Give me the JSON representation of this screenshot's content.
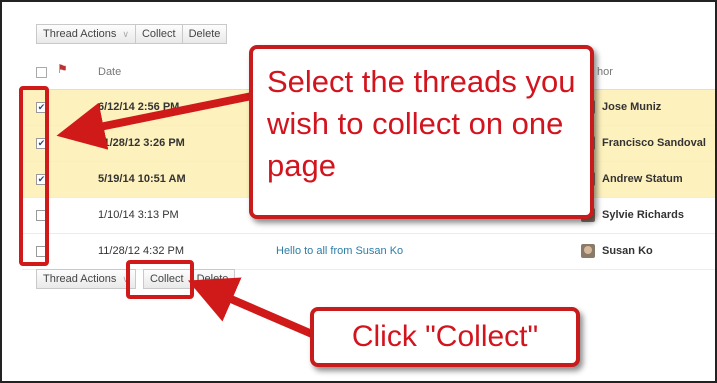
{
  "toolbar": {
    "thread_actions": "Thread Actions",
    "collect": "Collect",
    "delete": "Delete"
  },
  "header": {
    "date": "Date",
    "author_partial": "hor"
  },
  "rows": [
    {
      "date": "6/12/14 2:56 PM",
      "author": "Jose Muniz",
      "subject": "",
      "checked": true
    },
    {
      "date": "11/28/12 3:26 PM",
      "author": "Francisco Sandoval",
      "subject": "",
      "checked": true
    },
    {
      "date": "5/19/14 10:51 AM",
      "author": "Andrew Statum",
      "subject": "",
      "checked": true
    },
    {
      "date": "1/10/14 3:13 PM",
      "author": "Sylvie Richards",
      "subject": "",
      "checked": false
    },
    {
      "date": "11/28/12 4:32 PM",
      "author": "Susan Ko",
      "subject": "Hello to all from Susan Ko",
      "checked": false
    }
  ],
  "callouts": {
    "select_text": "Select the threads you wish to collect on one page",
    "click_text": "Click \"Collect\""
  },
  "colors": {
    "annotation_red": "#d01a1a",
    "selected_row": "#fdf1bd",
    "link_blue": "#2d7ea6"
  },
  "icons": {
    "checked": "✔",
    "flag": "flag-icon",
    "dropdown": "chevron-down-icon"
  }
}
